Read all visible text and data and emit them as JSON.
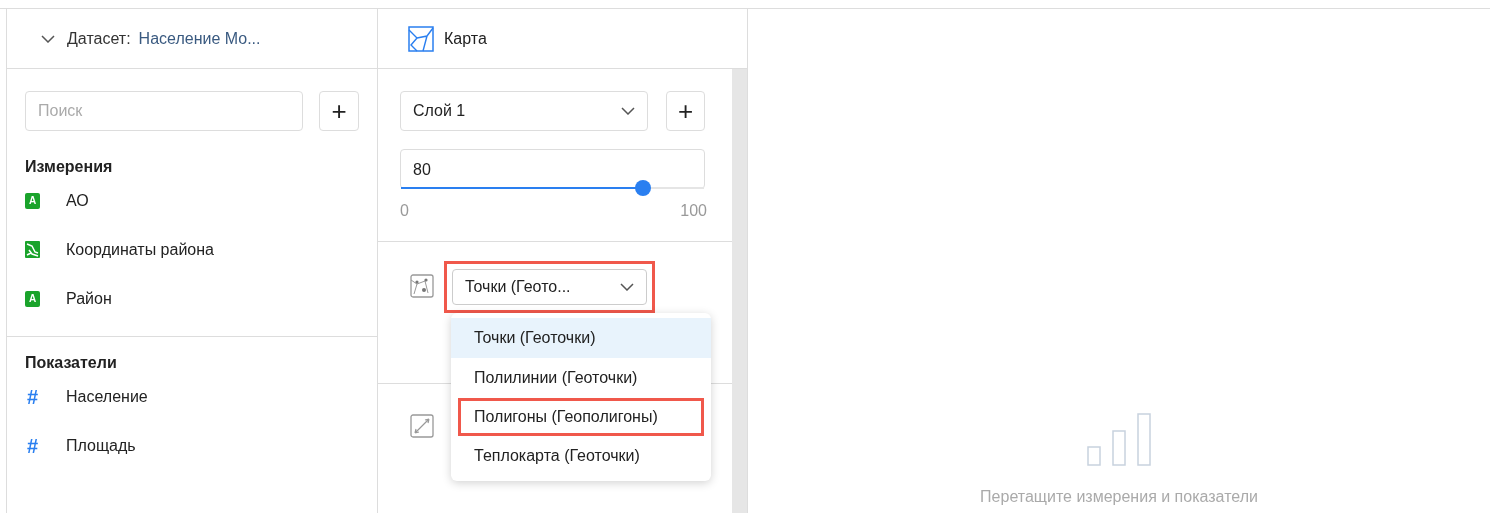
{
  "dataset": {
    "label": "Датасет:",
    "name": "Население Мо...",
    "expanded": true
  },
  "search": {
    "placeholder": "Поиск",
    "add": "+"
  },
  "sections": [
    {
      "title": "Измерения",
      "items": [
        {
          "kind": "text",
          "label": "АО",
          "icon_text": "A"
        },
        {
          "kind": "geo",
          "label": "Координаты района"
        },
        {
          "kind": "text",
          "label": "Район",
          "icon_text": "A"
        }
      ]
    },
    {
      "title": "Показатели",
      "items": [
        {
          "kind": "number",
          "label": "Население",
          "icon_text": "#"
        },
        {
          "kind": "number",
          "label": "Площадь",
          "icon_text": "#"
        }
      ]
    }
  ],
  "chart_type": {
    "label": "Карта"
  },
  "layer": {
    "value": "Слой 1",
    "add": "+"
  },
  "opacity": {
    "value": "80",
    "level": 0.8,
    "min": "0",
    "max": "100"
  },
  "geo_type": {
    "value": "Точки (Геото...",
    "highlighted": true,
    "options": [
      {
        "label": "Точки (Геоточки)",
        "selected": true,
        "highlighted": false
      },
      {
        "label": "Полилинии (Геоточки)",
        "selected": false,
        "highlighted": false
      },
      {
        "label": "Полигоны (Геополигоны)",
        "selected": false,
        "highlighted": true
      },
      {
        "label": "Теплокарта (Геоточки)",
        "selected": false,
        "highlighted": false
      }
    ]
  },
  "empty_state": {
    "message": "Перетащите измерения и показатели"
  }
}
